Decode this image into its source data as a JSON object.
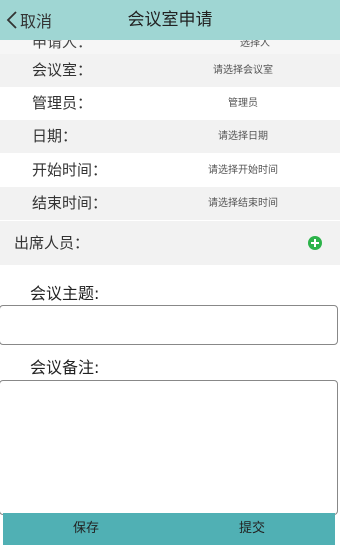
{
  "header": {
    "back_label": "取消",
    "title": "会议室申请"
  },
  "partial_row": {
    "label": "申请人：",
    "value": "选择人"
  },
  "fields": [
    {
      "label": "会议室：",
      "value": "请选择会议室"
    },
    {
      "label": "管理员：",
      "value": "管理员"
    },
    {
      "label": "日期：",
      "value": "请选择日期"
    },
    {
      "label": "开始时间：",
      "value": "请选择开始时间"
    },
    {
      "label": "结束时间：",
      "value": "请选择结束时间"
    }
  ],
  "attendees": {
    "label": "出席人员：",
    "add_icon": "plus-circle-icon",
    "add_color": "#2cb34a"
  },
  "topic": {
    "label": "会议主题:",
    "value": ""
  },
  "notes": {
    "label": "会议备注:",
    "value": ""
  },
  "footer": {
    "save_label": "保存",
    "submit_label": "提交",
    "bar_color": "#50b0b4"
  },
  "colors": {
    "header_bg": "#9fd6d3",
    "row_alt_bg": "#f2f2f2"
  }
}
